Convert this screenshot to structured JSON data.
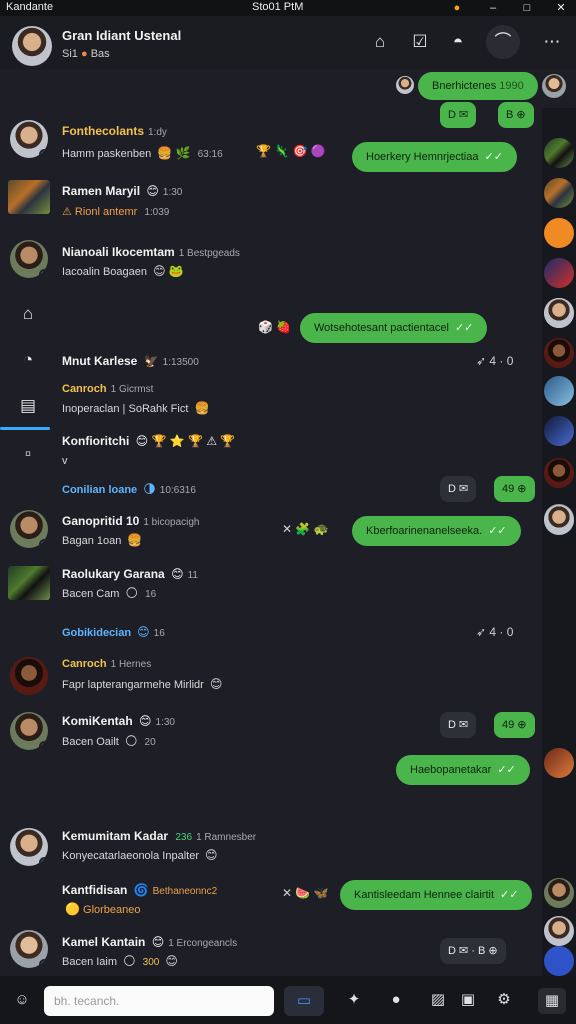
{
  "titlebar": {
    "app": "Kandante",
    "time": "Sto01 PtM"
  },
  "header": {
    "name": "Gran Idiant Ustenal",
    "sub": "Si1",
    "sub2": "Bas"
  },
  "top_bubble": {
    "text": "Bnerhictenes",
    "meta": "1990"
  },
  "top_chips": [
    "D",
    "B"
  ],
  "rows": [
    {
      "name": "Fonthecolants",
      "meta": "1:dy",
      "msg": "Hamm paskenben",
      "msg_meta": "63:16",
      "reactions": "🏆 🦎 🎯 🟣",
      "bubble": "Hoerkery Hemnrjectiaa"
    },
    {
      "name": "Ramen Maryil",
      "meta": "1:30",
      "msg": "Rionl antemr",
      "msg_meta": "1:039"
    },
    {
      "name": "Nianoali Ikocemtam",
      "meta": "1 Bestpgeads",
      "msg": "Iacoalin Boagaen"
    },
    {
      "bubble": "Wotsehotesant pactientacel",
      "reactions": "🎲 🍓"
    },
    {
      "name": "Mnut Karlese",
      "meta": "1:13500",
      "rx": "4 · 0"
    },
    {
      "name": "Canroch",
      "meta": "1 Gicrmst",
      "msg": "Inoperaclan",
      "msg_meta": "SoRahk Fict"
    },
    {
      "name": "Konfioritchi",
      "emojis": "😊 🏆 ⭐ 🏆 ⚠ 🏆",
      "msg": "v"
    },
    {
      "name": "Conilian loane",
      "meta": "10:6316",
      "chips": [
        "D",
        "49"
      ]
    },
    {
      "name": "Ganopritid 10",
      "meta": "1 bicopacigh",
      "msg": "Bagan 1oan",
      "reactions": "✕ 🧩 🐢",
      "bubble": "Kberfoarinenanelseeka."
    },
    {
      "name": "Raolukary Garana",
      "meta": "11",
      "msg": "Bacen Cam",
      "msg_meta": "16"
    },
    {
      "name": "Gobikidecian",
      "meta": "16",
      "rx": "4 · 0"
    },
    {
      "name": "Canroch",
      "meta": "1 Hernes",
      "msg": "Fapr lapterangarmehe Mirlidr"
    },
    {
      "name": "KomiKentah",
      "meta": "1:30",
      "msg": "Bacen Oailt",
      "msg_meta": "20",
      "chips": [
        "D",
        "49"
      ]
    },
    {
      "bubble": "Haebopanetakar"
    },
    {
      "name": "Kemumitam Kadar",
      "meta": "236",
      "meta2": "1 Ramnesber",
      "msg": "Konyecatarlaeonola Inpalter"
    },
    {
      "name": "Kantfidisan",
      "meta": "Bethaneonnc2",
      "msg": "Glorbeaneo",
      "reactions": "✕ 🍉 🦋",
      "bubble": "Kantisleedam Hennee clairtit"
    },
    {
      "name": "Kamel Kantain",
      "meta": "1 Ercongeancls",
      "msg": "Bacen Iaim",
      "msg_meta": "300",
      "chips": [
        "D",
        "B"
      ]
    }
  ],
  "input": {
    "placeholder": "bh. tecanch."
  }
}
